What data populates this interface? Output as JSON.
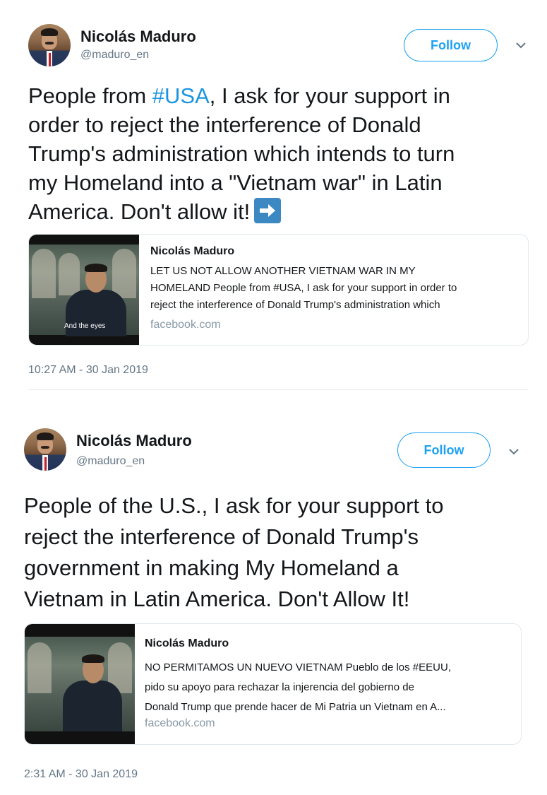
{
  "tweets": [
    {
      "author_name": "Nicolás Maduro",
      "author_handle": "@maduro_en",
      "follow_label": "Follow",
      "text_lines": [
        [
          "People from ",
          "#USA",
          ", I ask for your support in"
        ],
        "order to reject the interference of Donald",
        "Trump's administration which intends to turn",
        "my Homeland into a \"Vietnam war\" in Latin",
        "America. Don't allow it!"
      ],
      "emoji": "right-arrow-emoji",
      "card": {
        "title": "Nicolás Maduro",
        "description_lines": [
          "LET US NOT ALLOW ANOTHER VIETNAM WAR IN MY",
          "HOMELAND People from #USA, I ask for your support in order to",
          "reject the interference of Donald Trump's administration which"
        ],
        "domain": "facebook.com",
        "thumbnail_caption": "And the eyes"
      },
      "timestamp": "10:27 AM - 30 Jan 2019"
    },
    {
      "author_name": "Nicolás Maduro",
      "author_handle": "@maduro_en",
      "follow_label": "Follow",
      "text_lines": [
        "People of the U.S., I ask for your support to",
        "reject the interference of Donald Trump's",
        "government in making My Homeland a",
        "Vietnam in Latin America. Don't Allow It!"
      ],
      "card": {
        "title": "Nicolás Maduro",
        "description_lines": [
          "NO PERMITAMOS UN NUEVO VIETNAM Pueblo de los #EEUU,",
          "pido su apoyo para rechazar la injerencia del gobierno de",
          "Donald Trump que prende hacer de Mi Patria un Vietnam en A..."
        ],
        "domain": "facebook.com"
      },
      "timestamp": "2:31 AM - 30 Jan 2019"
    }
  ],
  "colors": {
    "accent": "#1da1f2",
    "hashtag": "#1b95e0",
    "secondary_text": "#657786",
    "domain_text": "#8899a6",
    "emoji_blue": "#3b88c3"
  }
}
